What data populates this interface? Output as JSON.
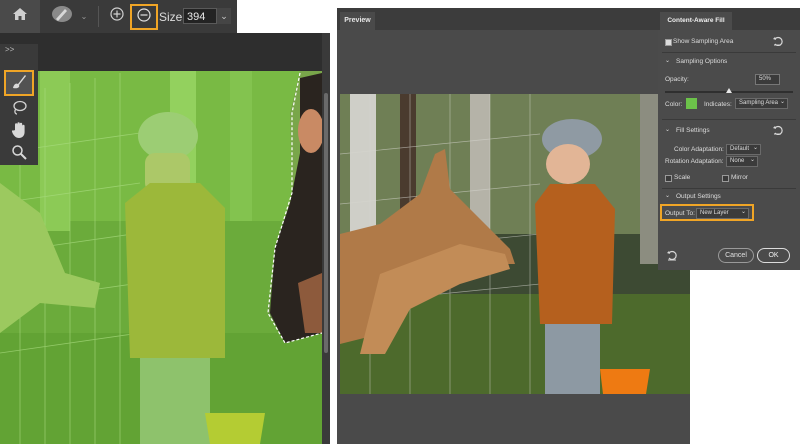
{
  "options_bar": {
    "size_label": "Size:",
    "size_value": "394",
    "icons": [
      "home-icon",
      "brush-icon",
      "add-sampling-icon",
      "subtract-sampling-icon",
      "chevron-down-icon"
    ]
  },
  "preview": {
    "tab_label": "Preview"
  },
  "caf_panel": {
    "title": "Content-Aware Fill",
    "show_sampling_area": "Show Sampling Area",
    "sampling_options": "Sampling Options",
    "opacity_label": "Opacity:",
    "opacity_value": "50%",
    "opacity_fraction": 0.5,
    "color_label": "Color:",
    "sampling_color": "#6cc24a",
    "indicates_label": "Indicates:",
    "indicates_value": "Sampling Area",
    "fill_settings": "Fill Settings",
    "color_adaptation_label": "Color Adaptation:",
    "color_adaptation_value": "Default",
    "rotation_adaptation_label": "Rotation Adaptation:",
    "rotation_adaptation_value": "None",
    "scale_label": "Scale",
    "mirror_label": "Mirror",
    "output_settings": "Output Settings",
    "output_to_label": "Output To:",
    "output_to_value": "New Layer",
    "cancel_label": "Cancel",
    "ok_label": "OK"
  },
  "colors": {
    "highlight": "#f0a526",
    "panel_bg": "#4b4b4b",
    "sampling_overlay": "#7bd23e"
  }
}
